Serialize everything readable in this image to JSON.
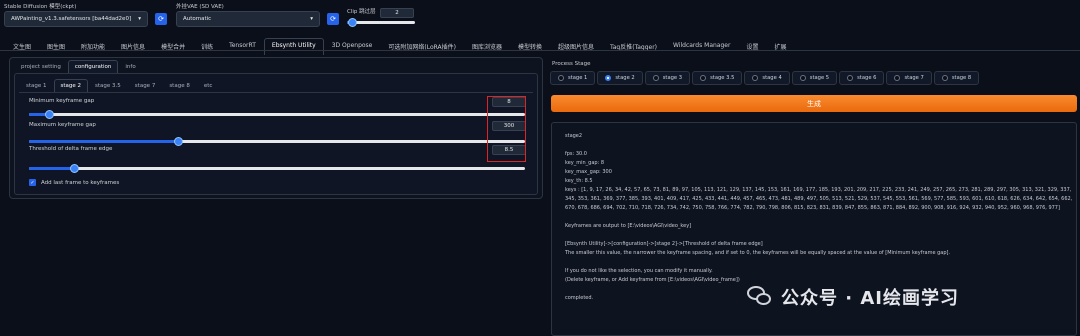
{
  "top": {
    "checkpoint_label": "Stable Diffusion 模型(ckpt)",
    "checkpoint_value": "AWPainting_v1.3.safetensors [ba44dad2e0]",
    "vae_label": "外挂VAE (SD VAE)",
    "vae_value": "Automatic",
    "clip_label": "Clip 跳过层",
    "clip_value": "2",
    "clip_level": 0.08
  },
  "main_tabs": [
    "文生图",
    "图生图",
    "附加功能",
    "图片信息",
    "模型合并",
    "训练",
    "TensorRT",
    "Ebsynth Utility",
    "3D Openpose",
    "可选附加网络(LoRA插件)",
    "图库浏览器",
    "模型转换",
    "超级图片信息",
    "Tag反推(Tagger)",
    "Wildcards Manager",
    "设置",
    "扩展"
  ],
  "main_tab_active": 7,
  "left": {
    "panel_tabs": [
      "project setting",
      "configuration",
      "info"
    ],
    "panel_tab_active": 1,
    "stage_tabs": [
      "stage 1",
      "stage 2",
      "stage 3.5",
      "stage 7",
      "stage 8",
      "etc"
    ],
    "stage_tab_active": 1,
    "sliders": [
      {
        "label": "Minimum keyframe gap",
        "value": "8",
        "level": 0.04
      },
      {
        "label": "Maximum keyframe gap",
        "value": "300",
        "level": 0.3
      },
      {
        "label": "Threshold of delta frame edge",
        "value": "8.5",
        "level": 0.09
      }
    ],
    "checkbox_label": "Add last frame to keyframes",
    "checkbox_checked": true
  },
  "right": {
    "process_label": "Process Stage",
    "stages": [
      "stage 1",
      "stage 2",
      "stage 3",
      "stage 3.5",
      "stage 4",
      "stage 5",
      "stage 6",
      "stage 7",
      "stage 8"
    ],
    "stage_selected": 1,
    "generate_label": "生成",
    "output": [
      "stage2",
      "",
      "fps: 30.0",
      "key_min_gap: 8",
      "key_max_gap: 300",
      "key_th: 8.5",
      "keys : [1, 9, 17, 26, 34, 42, 57, 65, 73, 81, 89, 97, 105, 113, 121, 129, 137, 145, 153, 161, 169, 177, 185, 193, 201, 209, 217, 225, 233, 241, 249, 257, 265, 273, 281, 289, 297, 305, 313, 321, 329, 337,",
      "345, 353, 361, 369, 377, 385, 393, 401, 409, 417, 425, 433, 441, 449, 457, 465, 473, 481, 489, 497, 505, 513, 521, 529, 537, 545, 553, 561, 569, 577, 585, 593, 601, 610, 618, 626, 634, 642, 654, 662,",
      "670, 678, 686, 694, 702, 710, 718, 726, 734, 742, 750, 758, 766, 774, 782, 790, 798, 806, 815, 823, 831, 839, 847, 855, 863, 871, 884, 892, 900, 908, 916, 924, 932, 940, 952, 960, 968, 976, 977]",
      "",
      "Keyframes are output to [E:\\videos\\AGI\\video_key]",
      "",
      "[Ebsynth Utility]->[configuration]->[stage 2]->[Threshold of delta frame edge]",
      "The smaller this value, the narrower the keyframe spacing, and if set to 0, the keyframes will be equally spaced at the value of [Minimum keyframe gap].",
      "",
      "If you do not like the selection, you can modify it manually.",
      "(Delete keyframe, or Add keyframe from [E:\\videos\\AGI\\video_frame])",
      "",
      "completed."
    ]
  },
  "watermark": "公众号 · AI绘画学习",
  "colors": {
    "background": "#0b0f19",
    "accent": "#2563eb",
    "generate": "#f97316",
    "highlight_box": "#dc2626"
  }
}
